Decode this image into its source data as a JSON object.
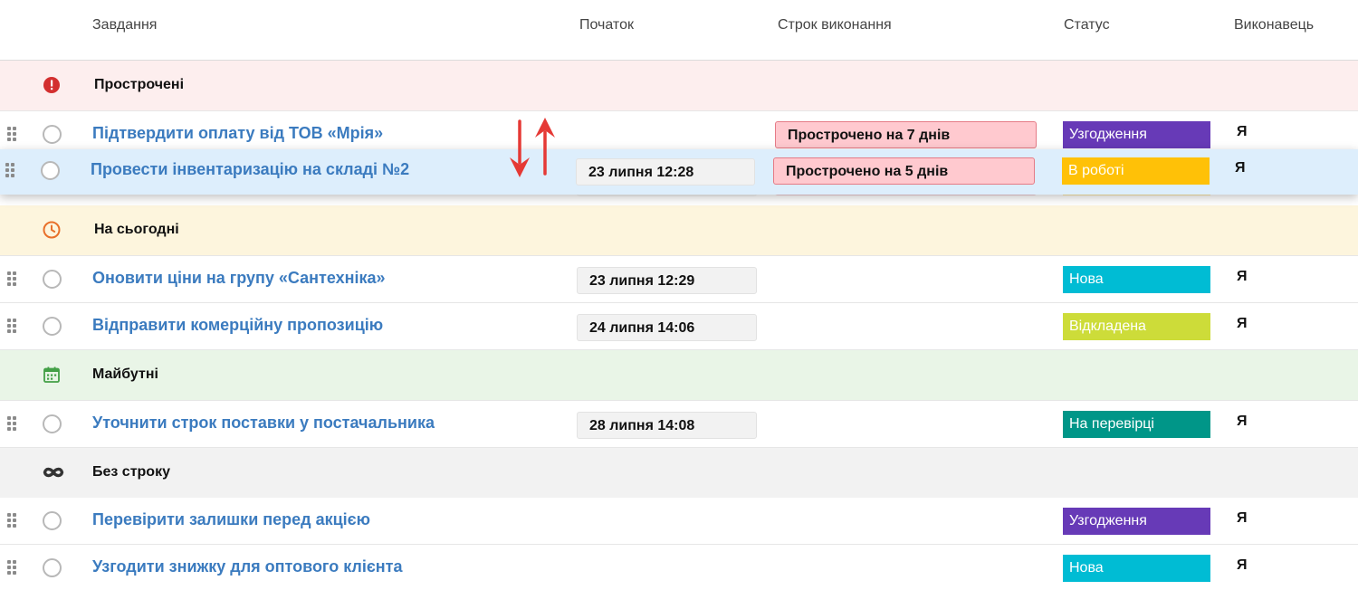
{
  "header": {
    "task": "Завдання",
    "start": "Початок",
    "deadline": "Строк виконання",
    "status": "Статус",
    "executor": "Виконавець"
  },
  "groups": {
    "overdue": {
      "label": "Прострочені",
      "icon": "alert-circle-icon",
      "bg": "#fdeeee",
      "color": "#d32f2f"
    },
    "today": {
      "label": "На сьогодні",
      "icon": "clock-icon",
      "bg": "#fdf5dd",
      "color": "#e8702a"
    },
    "future": {
      "label": "Майбутні",
      "icon": "calendar-icon",
      "bg": "#e9f5e7",
      "color": "#43a047"
    },
    "nodeadline": {
      "label": "Без строку",
      "icon": "infinity-icon",
      "bg": "#f2f2f2",
      "color": "#333333"
    }
  },
  "rows": {
    "r1": {
      "title": "Підтвердити оплату від ТОВ «Мрія»",
      "start": "",
      "deadline": "Прострочено на 7 днів",
      "status": "Узгодження",
      "status_color": "#673ab7",
      "executor": "Я"
    },
    "r2": {
      "title": "Провести інвентаризацію на складі №2",
      "start": "23 липня 12:28",
      "deadline": "Прострочено на 5 днів",
      "status": "В роботі",
      "status_color": "#ffc107",
      "executor": "Я"
    },
    "r3": {
      "title": "Оновити ціни на групу «Сантехніка»",
      "start": "23 липня 12:29",
      "deadline": "",
      "status": "Нова",
      "status_color": "#00bcd4",
      "executor": "Я"
    },
    "r4": {
      "title": "Відправити комерційну пропозицію",
      "start": "24 липня 14:06",
      "deadline": "",
      "status": "Відкладена",
      "status_color": "#cddc39",
      "executor": "Я"
    },
    "r5": {
      "title": "Уточнити строк поставки у постачальника",
      "start": "28 липня 14:08",
      "deadline": "",
      "status": "На перевірці",
      "status_color": "#009688",
      "executor": "Я"
    },
    "r6": {
      "title": "Перевірити залишки перед акцією",
      "start": "",
      "deadline": "",
      "status": "Узгодження",
      "status_color": "#673ab7",
      "executor": "Я"
    },
    "r7": {
      "title": "Узгодити знижку для оптового клієнта",
      "start": "",
      "deadline": "",
      "status": "Нова",
      "status_color": "#00bcd4",
      "executor": "Я"
    }
  },
  "arrow_color": "#e53935"
}
